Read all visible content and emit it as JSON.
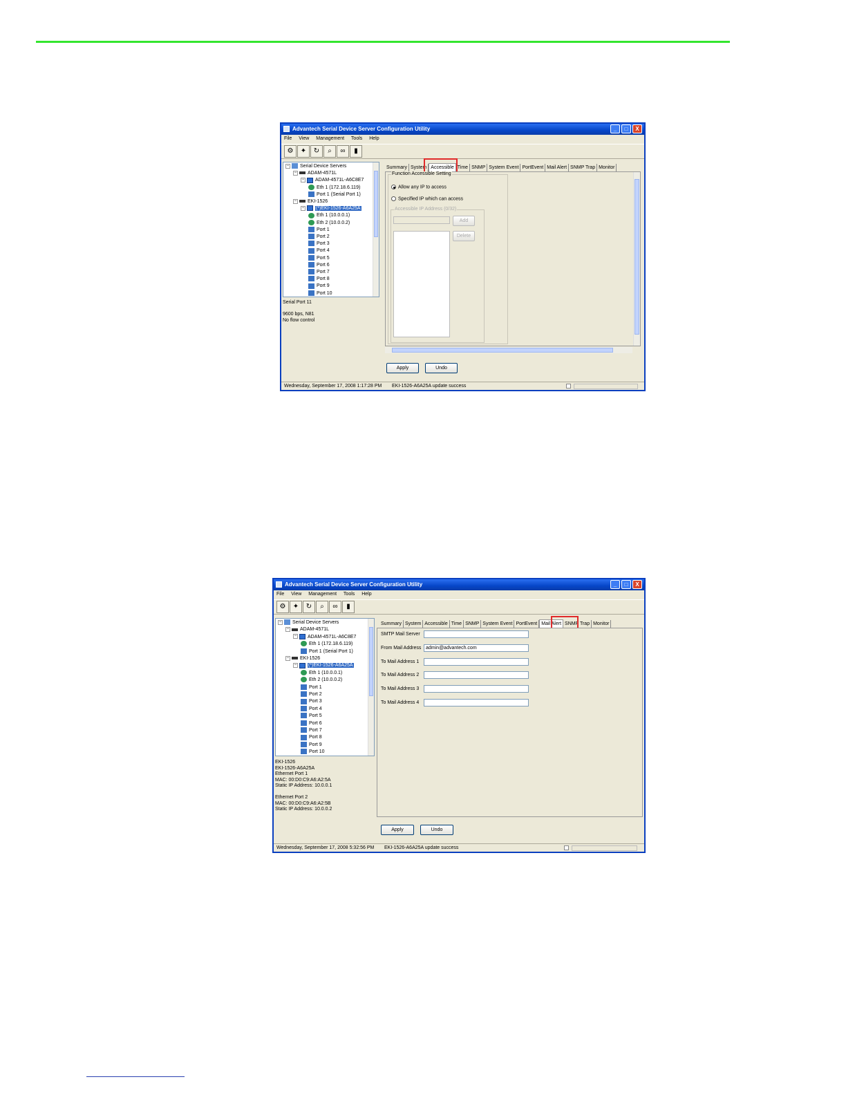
{
  "app_title": "Advantech Serial Device Server Configuration Utility",
  "menu": [
    "File",
    "View",
    "Management",
    "Tools",
    "Help"
  ],
  "title_buttons": {
    "minimize": "_",
    "maximize": "□",
    "close": "X"
  },
  "toolbar_icons": [
    "add-device-icon",
    "search-icon",
    "refresh-icon",
    "find-icon",
    "binoculars-icon",
    "device-server-icon"
  ],
  "colors": {
    "rule": "#33e52e",
    "titlebar": "#0646c8",
    "highlight": "#e02a2a",
    "selection": "#316ac5"
  },
  "tree": [
    {
      "label": "Serial Device Servers",
      "level": 0,
      "icon": "network-icon"
    },
    {
      "label": "ADAM-4571L",
      "level": 1,
      "icon": "device-group-icon"
    },
    {
      "label": "ADAM-4571L-A6C8E7",
      "level": 2,
      "icon": "device-icon"
    },
    {
      "label": "Eth 1 (172.18.6.119)",
      "level": 3,
      "icon": "ethernet-icon"
    },
    {
      "label": "Port 1 (Serial Port 1)",
      "level": 3,
      "icon": "serial-port-icon"
    },
    {
      "label": "EKI-1526",
      "level": 1,
      "icon": "device-group-icon"
    },
    {
      "label": "(*)EKI-1526-A6A25A",
      "level": 2,
      "icon": "device-icon",
      "selected": true
    },
    {
      "label": "Eth 1 (10.0.0.1)",
      "level": 3,
      "icon": "ethernet-icon"
    },
    {
      "label": "Eth 2 (10.0.0.2)",
      "level": 3,
      "icon": "ethernet-icon"
    },
    {
      "label": "Port 1",
      "level": 3,
      "icon": "serial-port-icon"
    },
    {
      "label": "Port 2",
      "level": 3,
      "icon": "serial-port-icon"
    },
    {
      "label": "Port 3",
      "level": 3,
      "icon": "serial-port-icon"
    },
    {
      "label": "Port 4",
      "level": 3,
      "icon": "serial-port-icon"
    },
    {
      "label": "Port 5",
      "level": 3,
      "icon": "serial-port-icon"
    },
    {
      "label": "Port 6",
      "level": 3,
      "icon": "serial-port-icon"
    },
    {
      "label": "Port 7",
      "level": 3,
      "icon": "serial-port-icon"
    },
    {
      "label": "Port 8",
      "level": 3,
      "icon": "serial-port-icon"
    },
    {
      "label": "Port 9",
      "level": 3,
      "icon": "serial-port-icon"
    },
    {
      "label": "Port 10",
      "level": 3,
      "icon": "serial-port-icon"
    }
  ],
  "tabs": [
    "Summary",
    "System",
    "Accessible",
    "Time",
    "SNMP",
    "System Event",
    "PortEvent",
    "Mail Alert",
    "SNMP Trap",
    "Monitor"
  ],
  "screen1": {
    "active_tab": "Accessible",
    "info_text": "Serial Port 11\n\n9600 bps, N81\nNo flow control",
    "group_title": "Function Accessible Setting",
    "radio_any": "Allow any IP to access",
    "radio_specified": "Specified IP which can access",
    "ip_group_title": "Accessible IP Address (0/32)",
    "add_button": "Add",
    "delete_button": "Delete",
    "apply_button": "Apply",
    "undo_button": "Undo",
    "status_time": "Wednesday, September 17, 2008  1:17:28 PM",
    "status_message": "EKI-1526-A6A25A update success"
  },
  "screen2": {
    "active_tab": "Mail Alert",
    "info_text": "EKI-1526\nEKI-1526-A6A25A\nEthernet Port 1\nMAC: 00:D0:C9:A6:A2:5A\nStatic IP Address: 10.0.0.1\n\nEthernet Port 2\nMAC: 00:D0:C9:A6:A2:5B\nStatic IP Address: 10.0.0.2",
    "fields": [
      {
        "label": "SMTP Mail Server",
        "value": ""
      },
      {
        "label": "From Mail Address",
        "value": "admin@advantech.com"
      },
      {
        "label": "To Mail Address 1",
        "value": ""
      },
      {
        "label": "To Mail Address 2",
        "value": ""
      },
      {
        "label": "To Mail Address 3",
        "value": ""
      },
      {
        "label": "To Mail Address 4",
        "value": ""
      }
    ],
    "apply_button": "Apply",
    "undo_button": "Undo",
    "status_time": "Wednesday, September 17, 2008  5:32:56 PM",
    "status_message": "EKI-1526-A6A25A update success"
  }
}
